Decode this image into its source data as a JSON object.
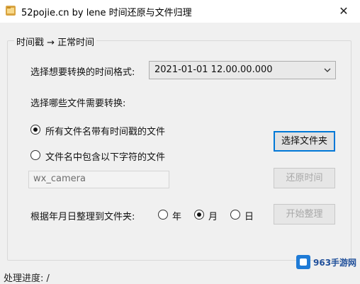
{
  "window": {
    "title": "52pojie.cn by lene 时间还原与文件归理",
    "close_label": "✕"
  },
  "group": {
    "title": "时间戳 → 正常时间"
  },
  "format": {
    "label": "选择想要转换的时间格式:",
    "selected": "2021-01-01 12.00.00.000"
  },
  "files": {
    "label": "选择哪些文件需要转换:",
    "option_timestamp": "所有文件名带有时间戳的文件",
    "option_contains": "文件名中包含以下字符的文件",
    "filter_placeholder": "wx_camera",
    "select_folder_button": "选择文件夹",
    "restore_button": "还原时间"
  },
  "organize": {
    "label": "根据年月日整理到文件夹:",
    "year": "年",
    "month": "月",
    "day": "日",
    "start_button": "开始整理"
  },
  "status": {
    "text": "处理进度: /"
  },
  "watermark": {
    "text": "963手游网"
  },
  "colors": {
    "accent": "#0078d7",
    "window_bg": "#f0f0f0"
  }
}
